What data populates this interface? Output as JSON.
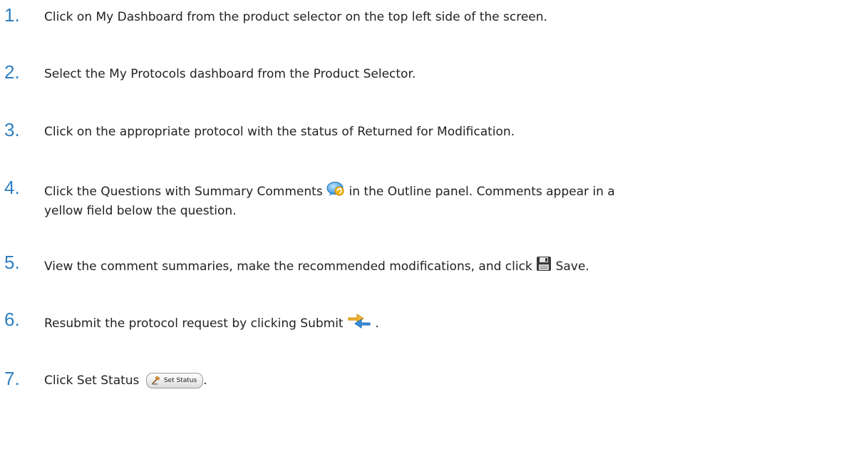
{
  "steps": [
    {
      "num": "1.",
      "text": "Click on My Dashboard from the product selector on the top left side of the screen."
    },
    {
      "num": "2.",
      "text": "Select the My Protocols dashboard from the Product Selector."
    },
    {
      "num": "3.",
      "text": "Click on the appropriate protocol with the status of Returned for Modification."
    },
    {
      "num": "4.",
      "text_before": "Click the Questions with Summary Comments",
      "text_after": "in the Outline panel. Comments appear in a",
      "text_line2": "yellow field below the question.",
      "icon": "summary-comments-icon"
    },
    {
      "num": "5.",
      "text_before": "View the comment summaries, make the recommended modifications, and click",
      "text_after": "Save.",
      "icon": "save-icon"
    },
    {
      "num": "6.",
      "text_before": "Resubmit the protocol request by clicking Submit",
      "text_after": ".",
      "icon": "submit-arrow-icon"
    },
    {
      "num": "7.",
      "text_before": "Click Set Status",
      "text_after": ".",
      "button_label": "Set Status",
      "icon": "gavel-icon"
    }
  ]
}
